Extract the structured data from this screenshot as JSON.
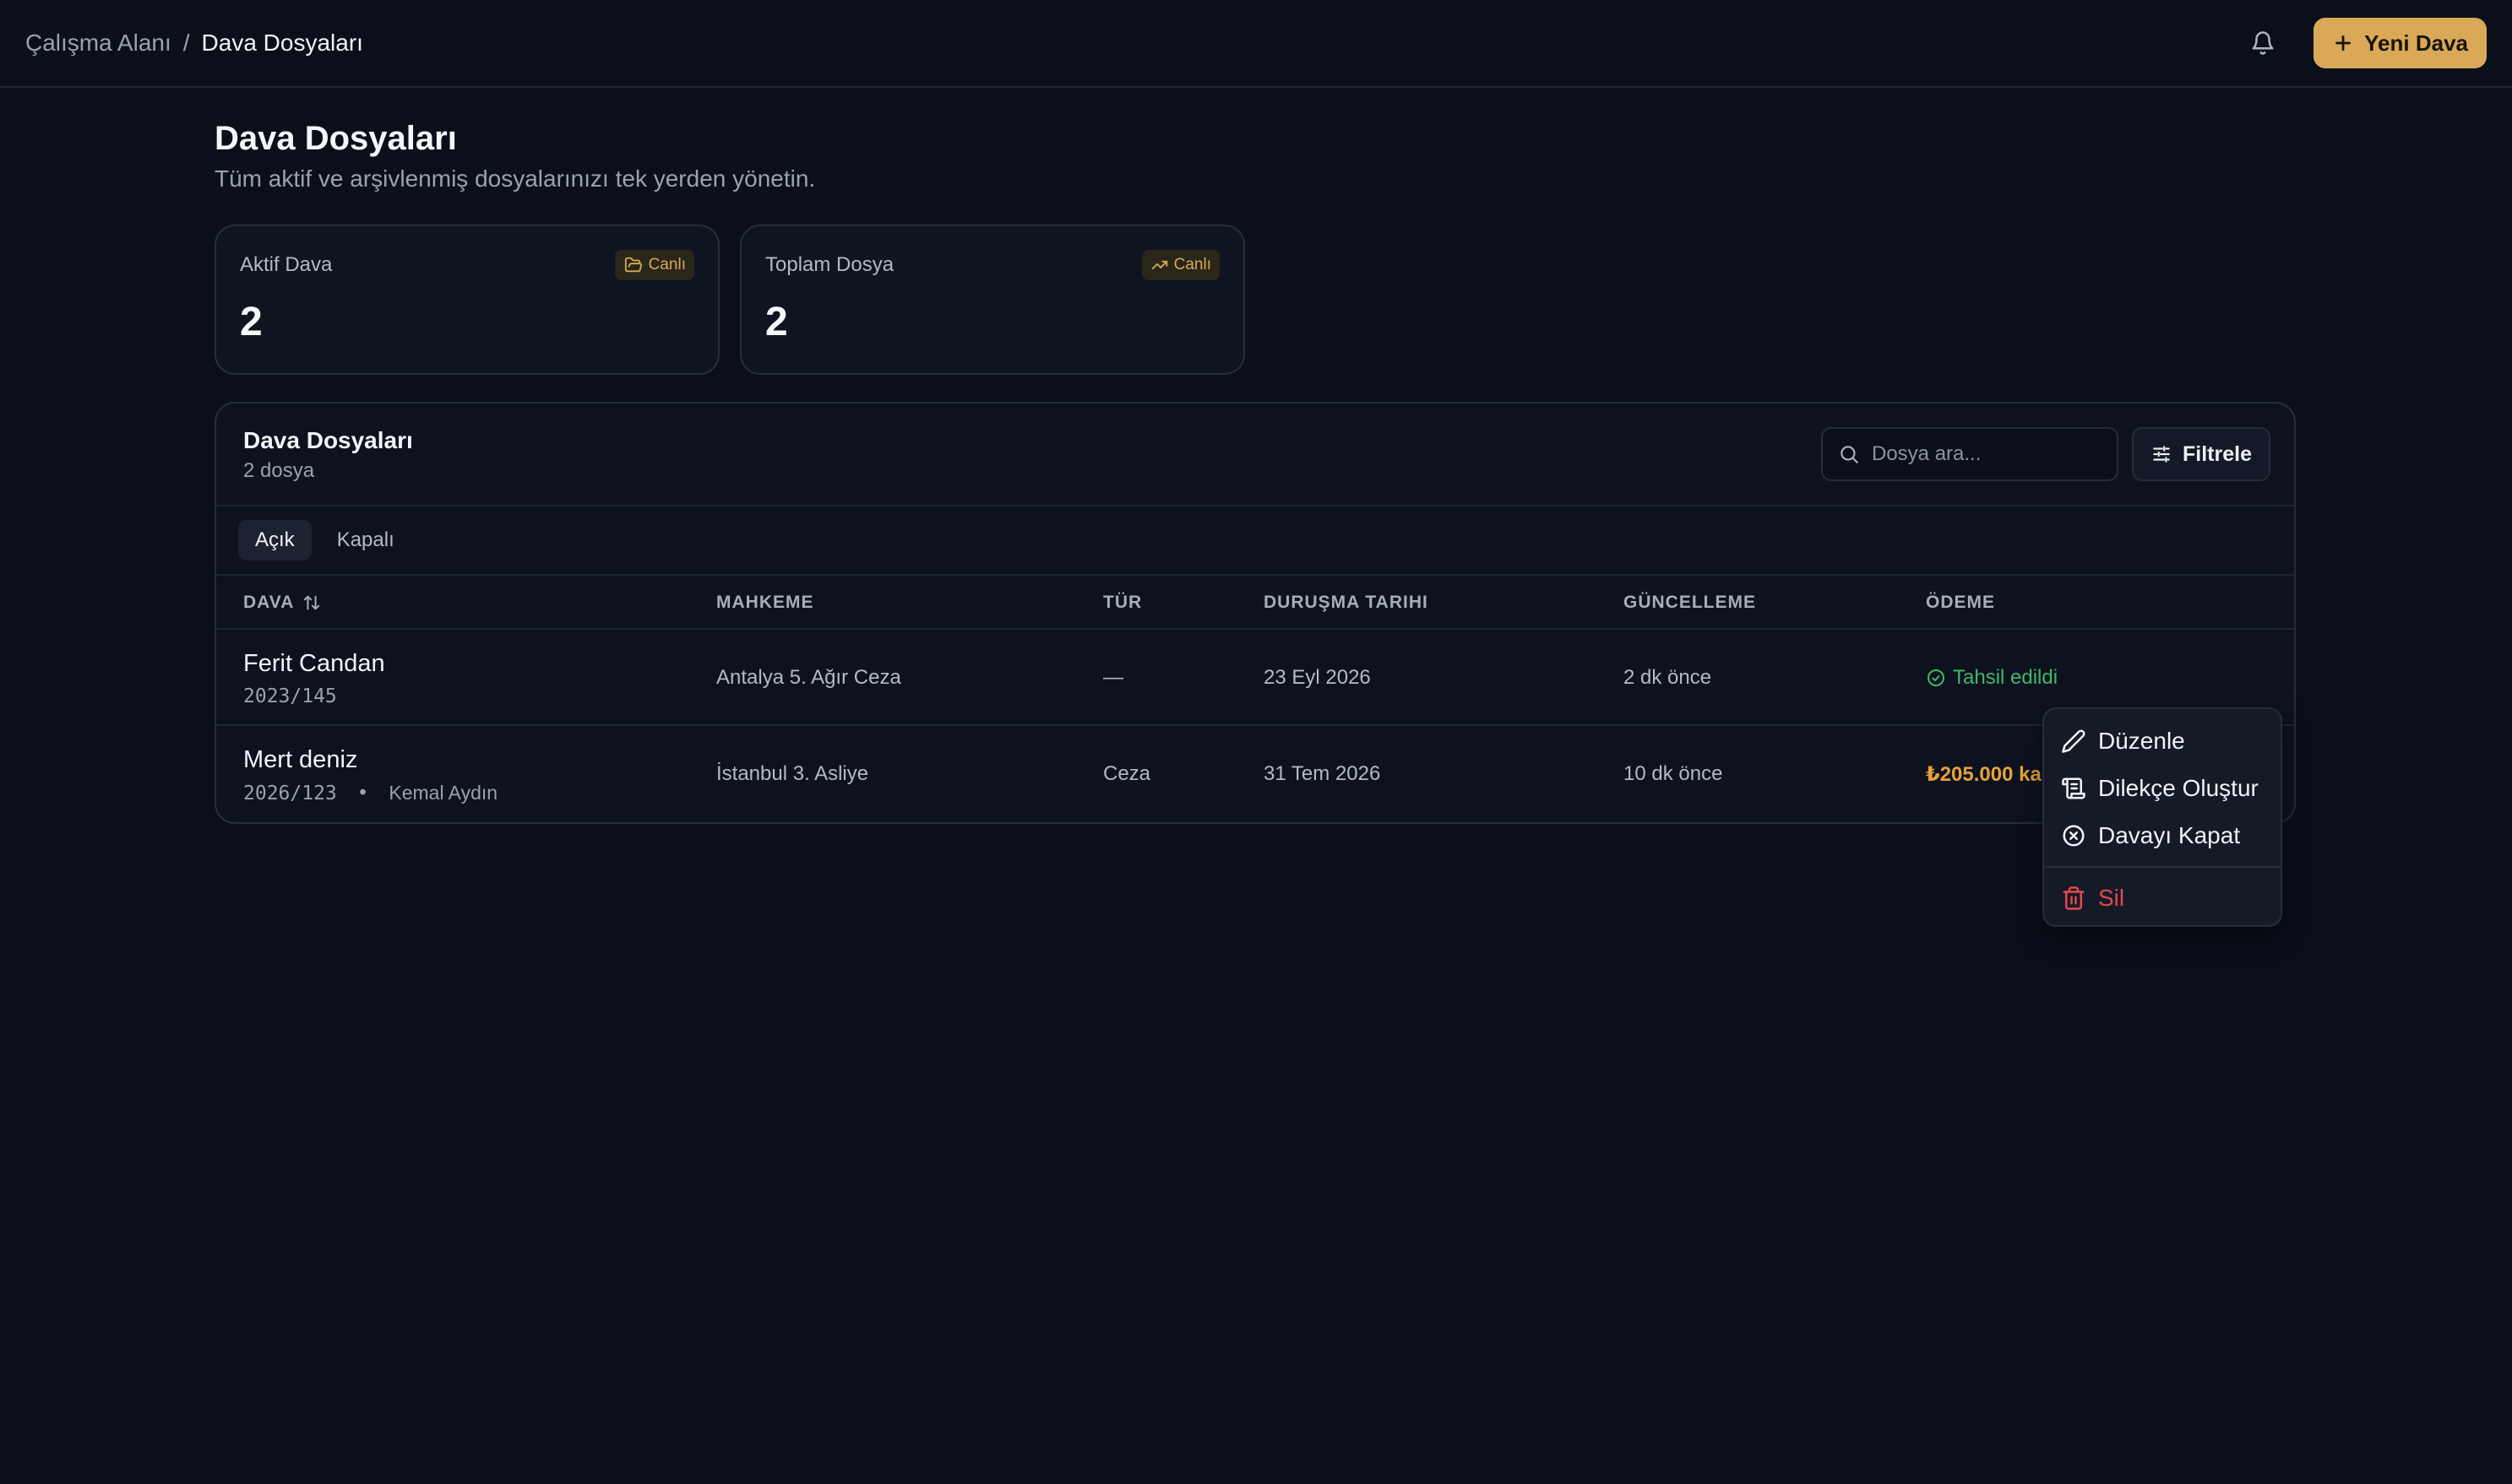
{
  "breadcrumb": {
    "root": "Çalışma Alanı",
    "separator": "/",
    "current": "Dava Dosyaları"
  },
  "topbar": {
    "new_button": "Yeni Dava",
    "bell_icon": "bell-icon",
    "plus_icon": "plus-icon"
  },
  "header": {
    "title": "Dava Dosyaları",
    "subtitle": "Tüm aktif ve arşivlenmiş dosyalarınızı tek yerden yönetin."
  },
  "stats": [
    {
      "label": "Aktif Dava",
      "badge": "Canlı",
      "badge_icon": "folder-open-icon",
      "value": "2"
    },
    {
      "label": "Toplam Dosya",
      "badge": "Canlı",
      "badge_icon": "trending-up-icon",
      "value": "2"
    }
  ],
  "table": {
    "title": "Dava Dosyaları",
    "count": "2 dosya",
    "search_placeholder": "Dosya ara...",
    "filter_label": "Filtrele",
    "tabs": [
      {
        "label": "Açık",
        "active": true
      },
      {
        "label": "Kapalı",
        "active": false
      }
    ],
    "columns": [
      "DAVA",
      "MAHKEME",
      "TÜR",
      "DURUŞMA TARIHI",
      "GÜNCELLEME",
      "ÖDEME"
    ],
    "rows": [
      {
        "name": "Ferit Candan",
        "file_no": "2023/145",
        "person": "",
        "court": "Antalya 5. Ağır Ceza",
        "type": "—",
        "hearing": "23 Eyl 2026",
        "updated": "2 dk önce",
        "payment": "Tahsil edildi",
        "payment_status": "paid"
      },
      {
        "name": "Mert deniz",
        "file_no": "2026/123",
        "separator": "•",
        "person": "Kemal Aydın",
        "court": "İstanbul 3. Asliye",
        "type": "Ceza",
        "hearing": "31 Tem 2026",
        "updated": "10 dk önce",
        "payment": "₺205.000 ka",
        "payment_status": "due"
      }
    ]
  },
  "context_menu": {
    "items": [
      {
        "label": "Düzenle",
        "icon": "pencil-icon"
      },
      {
        "label": "Dilekçe Oluştur",
        "icon": "scroll-icon"
      },
      {
        "label": "Davayı Kapat",
        "icon": "x-circle-icon"
      }
    ],
    "danger_item": {
      "label": "Sil",
      "icon": "trash-icon"
    }
  },
  "colors": {
    "background": "#0b0f1a",
    "accent": "#d9a957",
    "success": "#3fb86b",
    "warning": "#e8a23a",
    "danger": "#e5484d"
  }
}
